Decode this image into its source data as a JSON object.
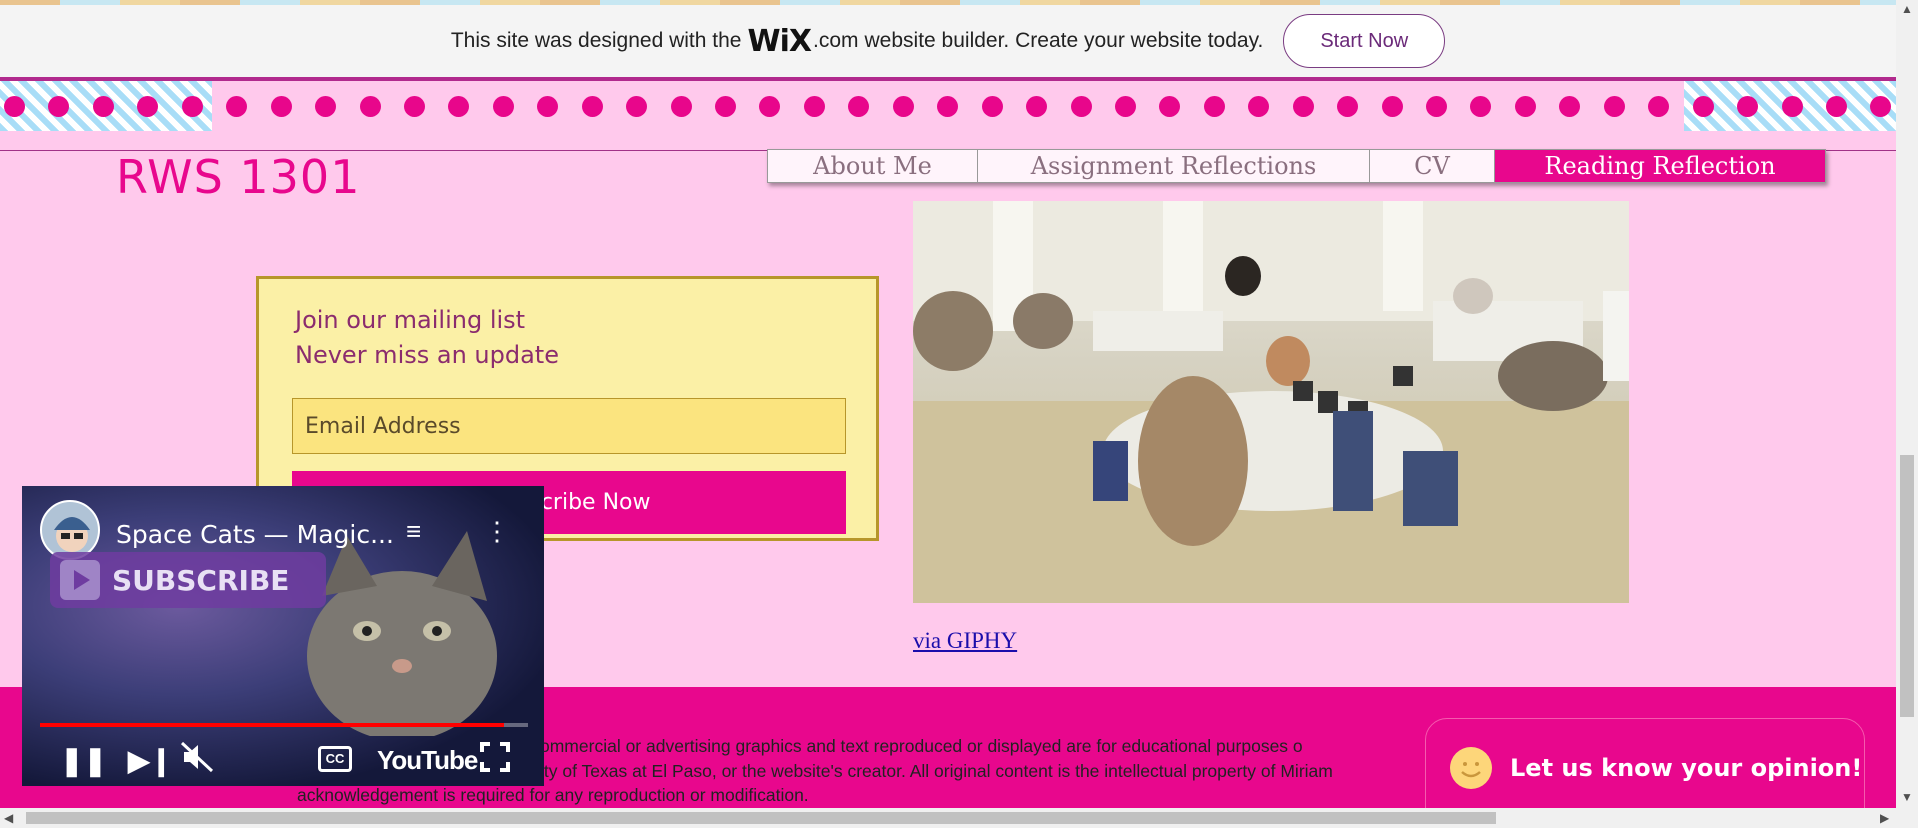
{
  "wix_banner": {
    "text_before": "This site was designed with the",
    "logo": "WiX",
    "logo_suffix": ".com",
    "text_after": "website builder. Create your website today.",
    "button": "Start Now"
  },
  "header": {
    "site_title": "RWS 1301",
    "nav": [
      {
        "label": "About Me",
        "active": false
      },
      {
        "label": "Assignment Reflections",
        "active": false
      },
      {
        "label": "CV",
        "active": false
      },
      {
        "label": "Reading Reflection",
        "active": true
      }
    ]
  },
  "mailing": {
    "heading_line1": "Join our mailing list",
    "heading_line2": "Never miss an update",
    "email_placeholder": "Email Address",
    "subscribe_label": "Subscribe Now"
  },
  "giphy": {
    "link_text": "via GIPHY"
  },
  "footer": {
    "text_line1": "ommercial or advertising graphics and text reproduced or displayed are for educational purposes o",
    "text_line2": "ity of Texas at El Paso, or the website's creator. All original content is the intellectual property of Miriam",
    "text_line3": "acknowledgement is required for any reproduction or modification."
  },
  "opinion_widget": {
    "label": "Let us know your opinion!"
  },
  "video": {
    "title": "Space Cats — Magic...",
    "subscribe_label": "SUBSCRIBE",
    "youtube_label": "YouTube",
    "progress": 0.95
  },
  "colors": {
    "brand_pink": "#e8078d",
    "background_pink": "#ffc9ec",
    "mail_box_yellow": "#fbf0a6"
  }
}
